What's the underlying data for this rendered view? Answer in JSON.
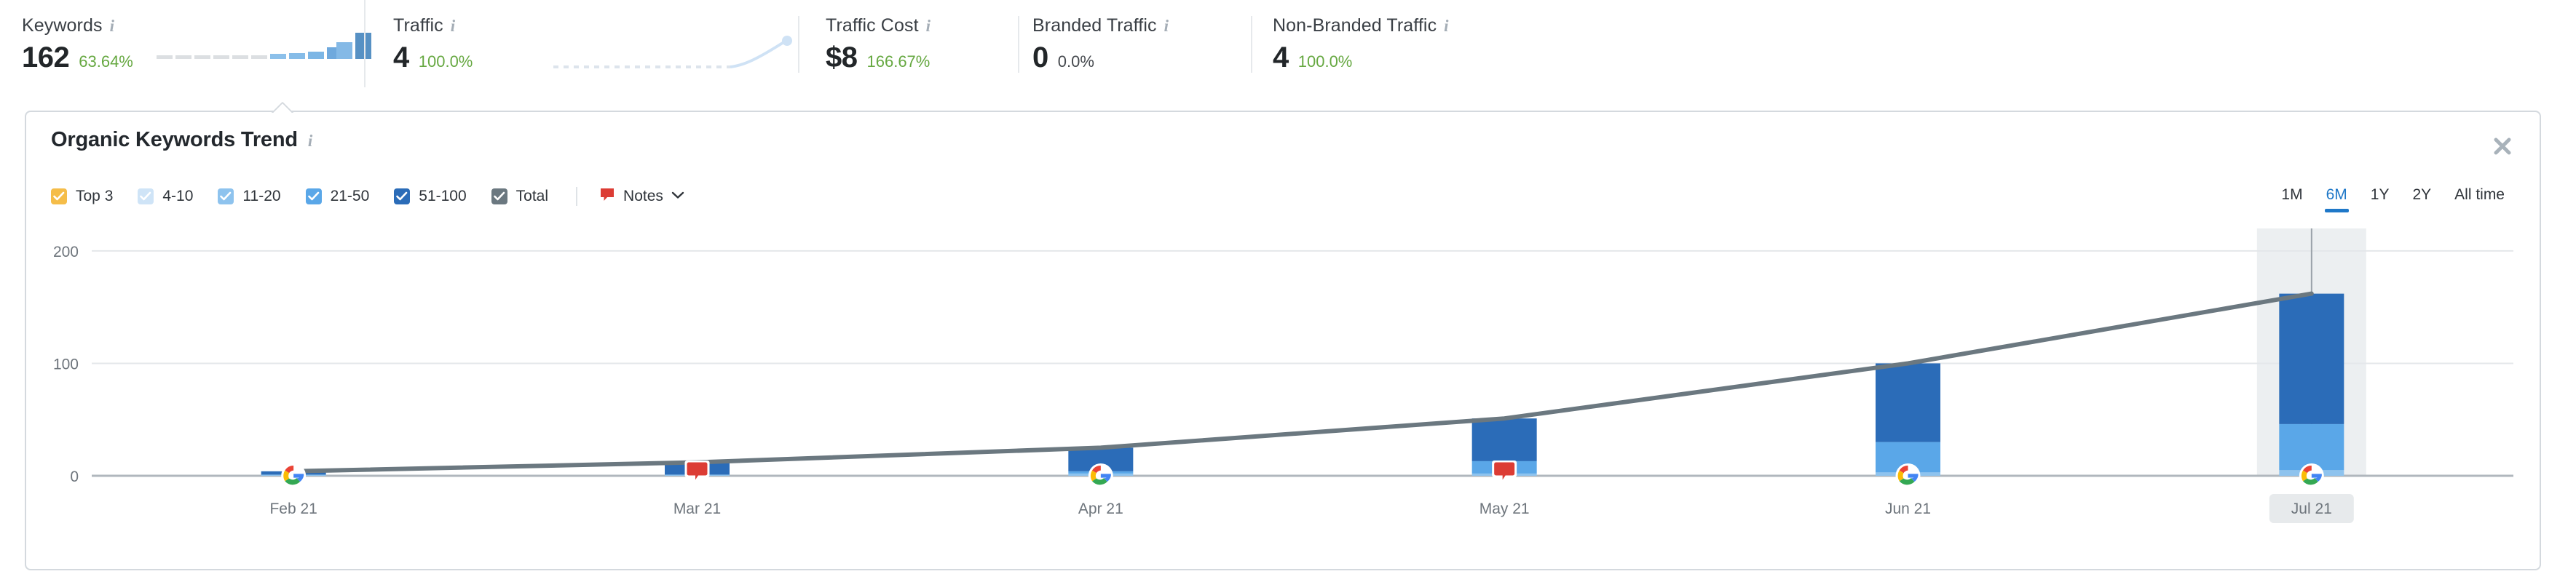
{
  "metrics": [
    {
      "title": "Keywords",
      "info_icon": "info-icon",
      "value": "162",
      "delta": "63.64%",
      "delta_dir": "up",
      "spark": "bars"
    },
    {
      "title": "Traffic",
      "info_icon": "info-icon",
      "value": "4",
      "delta": "100.0%",
      "delta_dir": "up",
      "spark": "line"
    },
    {
      "title": "Traffic Cost",
      "info_icon": "info-icon",
      "value": "$8",
      "delta": "166.67%",
      "delta_dir": "up",
      "spark": "none"
    },
    {
      "title": "Branded Traffic",
      "info_icon": "info-icon",
      "value": "0",
      "delta": "0.0%",
      "delta_dir": "flat",
      "spark": "none"
    },
    {
      "title": "Non-Branded Traffic",
      "info_icon": "info-icon",
      "value": "4",
      "delta": "100.0%",
      "delta_dir": "up",
      "spark": "none"
    }
  ],
  "panel": {
    "title": "Organic Keywords Trend",
    "title_info_icon": "info-icon",
    "close_icon": "close-icon",
    "notes": {
      "label": "Notes",
      "icon": "note-pin-icon",
      "chevron": "chevron-down-icon"
    },
    "legend": [
      {
        "label": "Top 3",
        "color": "#f5bd49",
        "checked": true
      },
      {
        "label": "4-10",
        "color": "#cfe4f7",
        "checked": true
      },
      {
        "label": "11-20",
        "color": "#8ec3ee",
        "checked": true
      },
      {
        "label": "21-50",
        "color": "#5aa7e8",
        "checked": true
      },
      {
        "label": "51-100",
        "color": "#2b6cb8",
        "checked": true
      },
      {
        "label": "Total",
        "color": "#6b7880",
        "checked": true
      }
    ],
    "ranges": [
      {
        "label": "1M",
        "active": false
      },
      {
        "label": "6M",
        "active": true
      },
      {
        "label": "1Y",
        "active": false
      },
      {
        "label": "2Y",
        "active": false
      },
      {
        "label": "All time",
        "active": false
      }
    ],
    "active_range_color": "#1f78c8"
  },
  "chart_data": {
    "type": "bar",
    "title": "Organic Keywords Trend",
    "xlabel": "",
    "ylabel": "",
    "ylim": [
      0,
      220
    ],
    "yticks": [
      0,
      100,
      200
    ],
    "ytick_labels": [
      "0",
      "100",
      "200"
    ],
    "grid": true,
    "legend_position": "top-left",
    "categories": [
      "Feb 21",
      "Mar 21",
      "Apr 21",
      "May 21",
      "Jun 21",
      "Jul 21"
    ],
    "highlighted_category": "Jul 21",
    "series": [
      {
        "name": "Top 3",
        "color": "#f5bd49",
        "values": [
          0,
          0,
          0,
          0,
          0,
          0
        ]
      },
      {
        "name": "4-10",
        "color": "#cfe4f7",
        "values": [
          0,
          0,
          0,
          0,
          0,
          0
        ]
      },
      {
        "name": "11-20",
        "color": "#8ec3ee",
        "values": [
          1,
          1,
          2,
          2,
          3,
          5
        ]
      },
      {
        "name": "21-50",
        "color": "#5aa7e8",
        "values": [
          0,
          0,
          2,
          11,
          27,
          41
        ]
      },
      {
        "name": "51-100",
        "color": "#2b6cb8",
        "values": [
          3,
          11,
          21,
          38,
          70,
          116
        ]
      }
    ],
    "totals": [
      4,
      12,
      25,
      51,
      100,
      162
    ],
    "total_line": {
      "name": "Total",
      "color": "#6b7880",
      "values": [
        4,
        12,
        25,
        51,
        100,
        162
      ]
    },
    "markers": [
      {
        "category": "Feb 21",
        "type": "google-icon"
      },
      {
        "category": "Mar 21",
        "type": "note-pin-icon"
      },
      {
        "category": "Apr 21",
        "type": "google-icon"
      },
      {
        "category": "May 21",
        "type": "note-pin-icon"
      },
      {
        "category": "Jun 21",
        "type": "google-icon"
      },
      {
        "category": "Jul 21",
        "type": "google-icon"
      }
    ]
  }
}
